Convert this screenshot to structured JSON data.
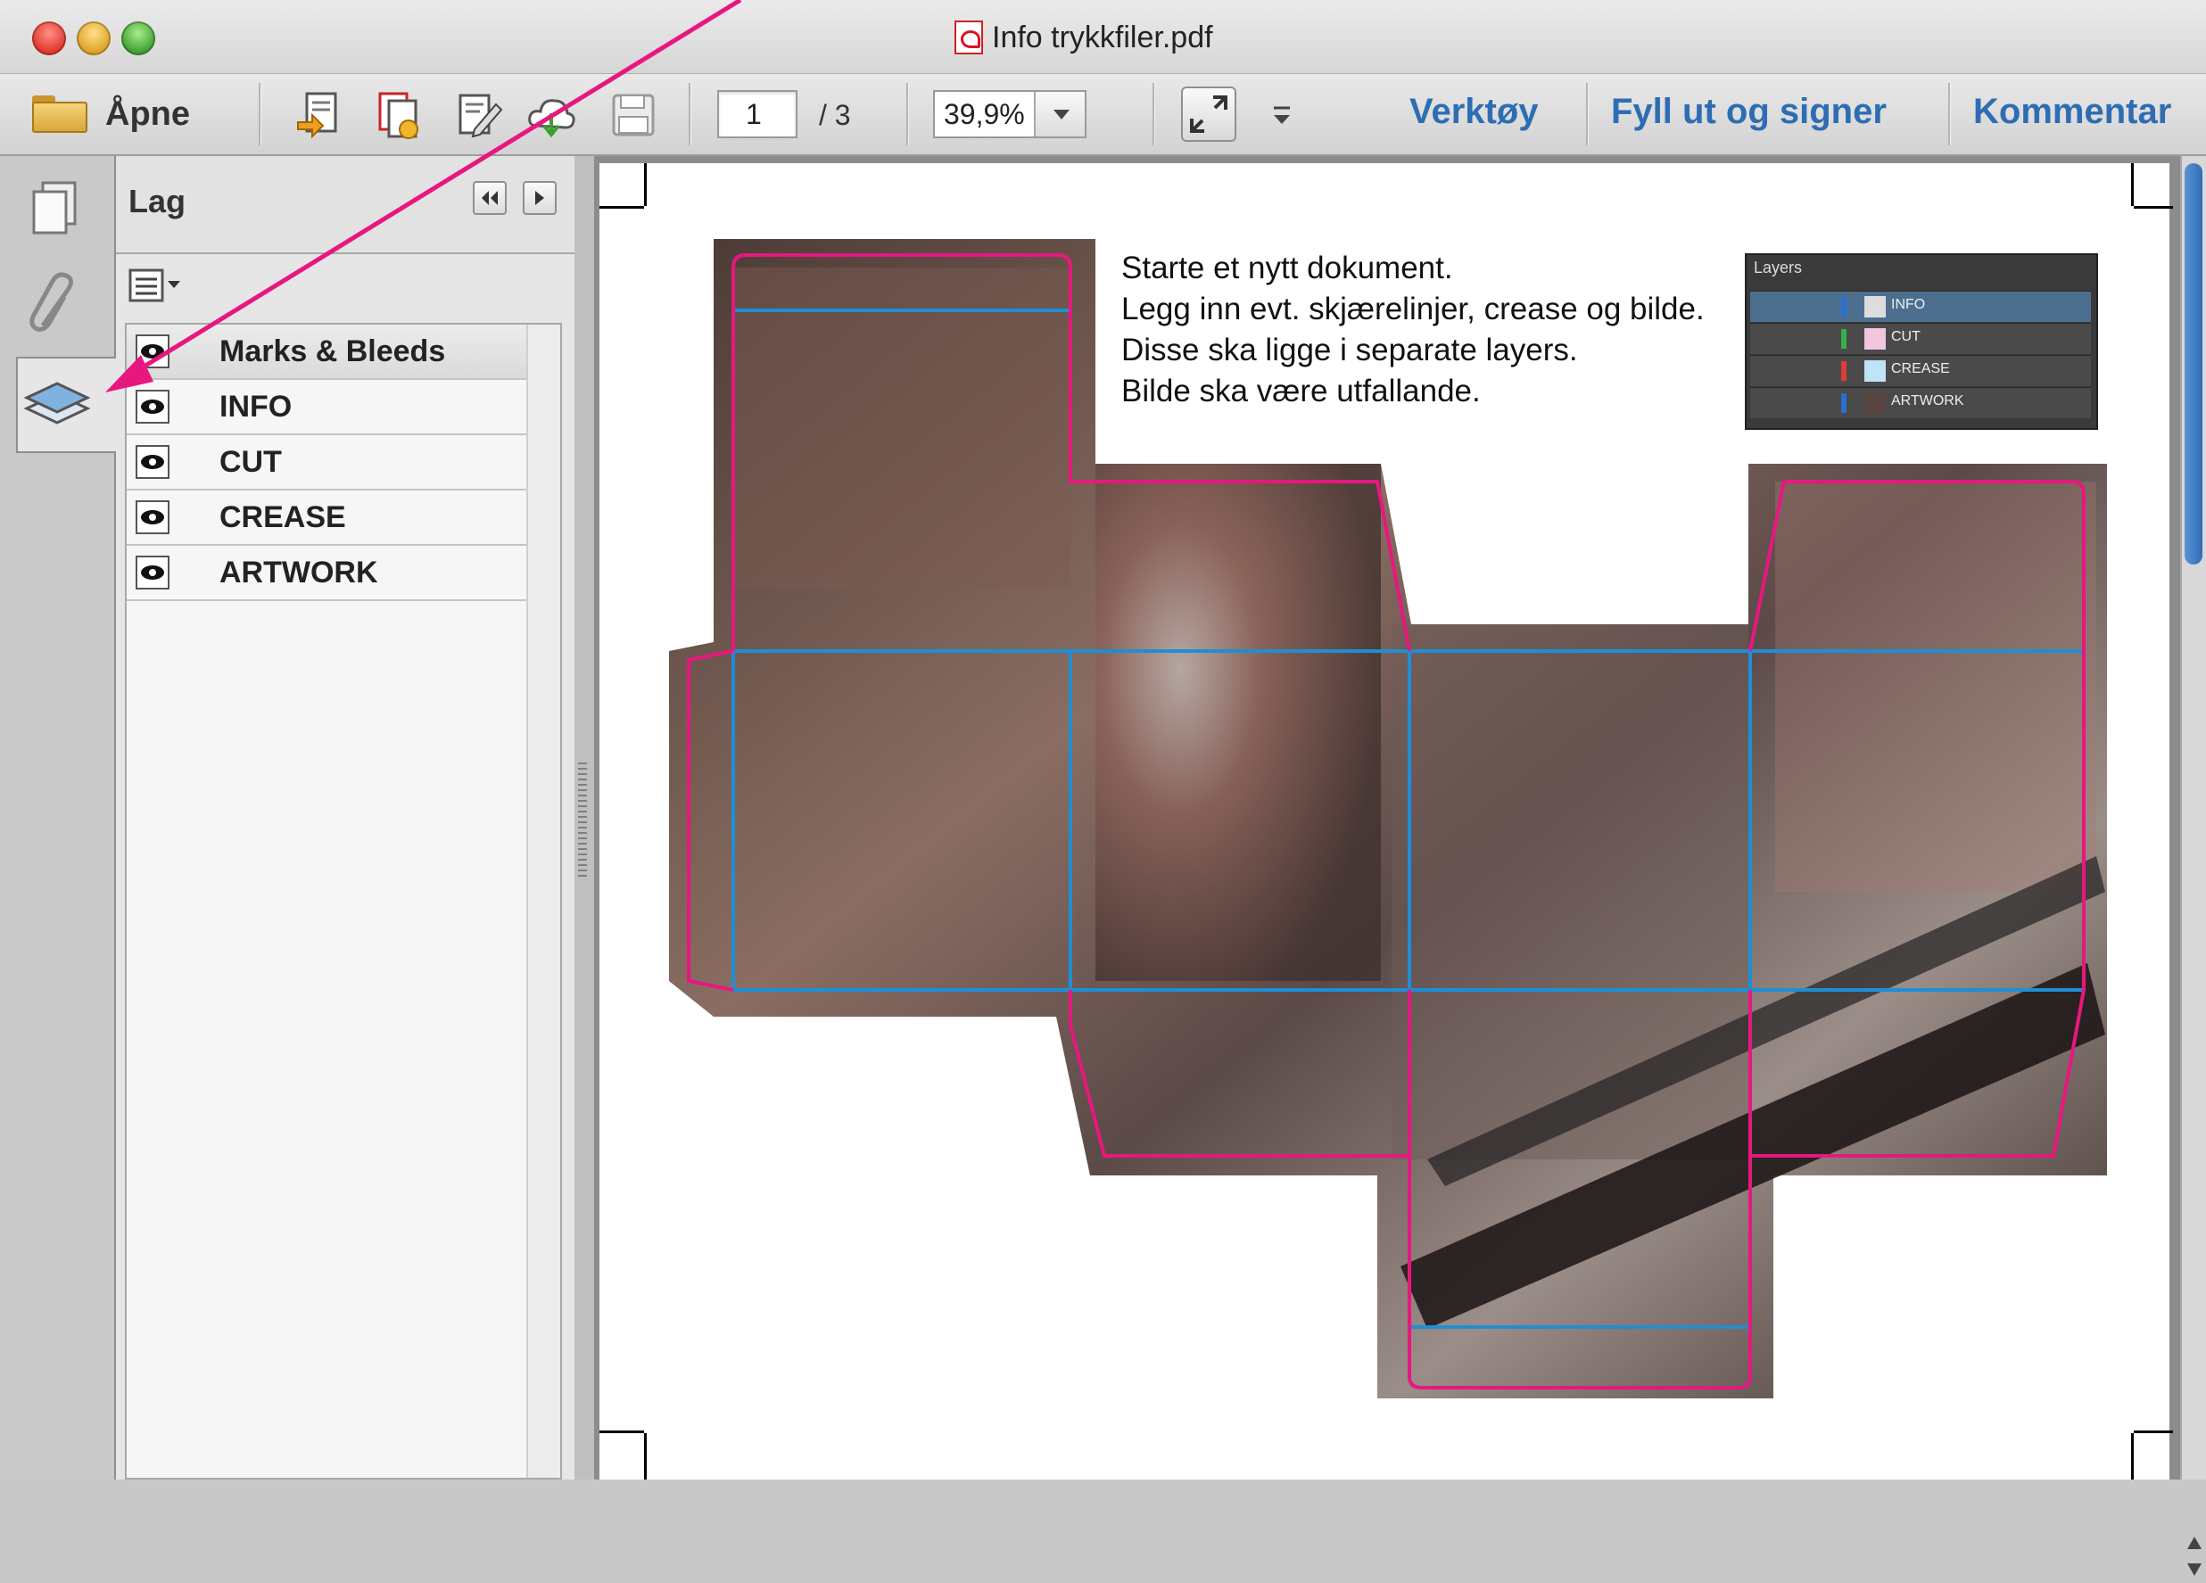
{
  "window": {
    "title": "Info trykkfiler.pdf"
  },
  "toolbar": {
    "open_label": "Åpne",
    "page_current": "1",
    "page_total": "/ 3",
    "zoom": "39,9%",
    "tabs": [
      {
        "label": "Verktøy"
      },
      {
        "label": "Fyll ut og signer"
      },
      {
        "label": "Kommentar"
      }
    ]
  },
  "layers_panel": {
    "title": "Lag",
    "header_layer": "Marks & Bleeds",
    "layers": [
      "INFO",
      "CUT",
      "CREASE",
      "ARTWORK"
    ]
  },
  "document": {
    "lines": [
      "Starte et nytt dokument.",
      "Legg inn evt. skjærelinjer, crease og bilde.",
      "Disse ska ligge i separate layers.",
      "Bilde ska være utfallande."
    ],
    "mini_panel": {
      "title": "Layers",
      "rows": [
        "INFO",
        "CUT",
        "CREASE",
        "ARTWORK"
      ]
    }
  },
  "colors": {
    "cut_line": "#e8177f",
    "crease_line": "#1e8fd6",
    "accent": "#2d6db3",
    "annotation_arrow": "#e8177f"
  },
  "icons": [
    "folder-icon",
    "create-pdf-icon",
    "combine-icon",
    "edit-icon",
    "cloud-icon",
    "save-icon",
    "fullscreen-icon",
    "pages-icon",
    "attachment-icon",
    "layers-icon",
    "eye-icon"
  ]
}
